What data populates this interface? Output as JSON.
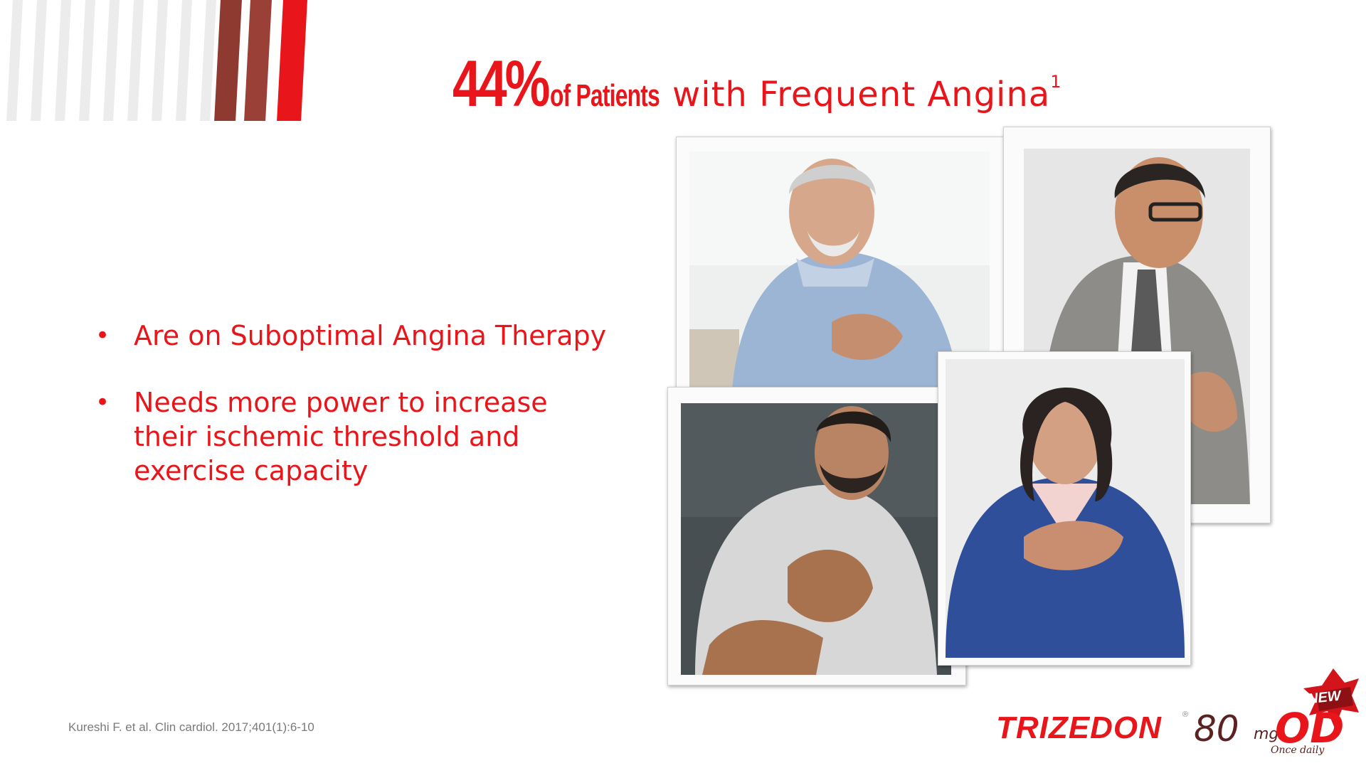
{
  "title": {
    "percent": "44%",
    "patients": "of Patients",
    "rest": "with Frequent Angina",
    "superscript": "1"
  },
  "bullets": [
    "Are on Suboptimal Angina Therapy",
    "Needs more power to increase their ischemic threshold and exercise capacity"
  ],
  "citation": "Kureshi F. et al. Clin cardiol. 2017;401(1):6-10",
  "logo": {
    "brand": "TRIZEDON",
    "registered": "®",
    "dose": "80",
    "unit": "mg",
    "od": "OD",
    "once_daily": "Once daily",
    "badge": "NEW"
  },
  "colors": {
    "accent": "#e8161b",
    "stripe_dark": "#8e3a31",
    "stripe_light": "#ececec",
    "logo_dark": "#5a2220"
  },
  "photos": [
    "older-man-chest-pain-photo",
    "businessman-chest-pain-photo",
    "bearded-man-chest-pain-photo",
    "woman-chest-pain-photo"
  ]
}
